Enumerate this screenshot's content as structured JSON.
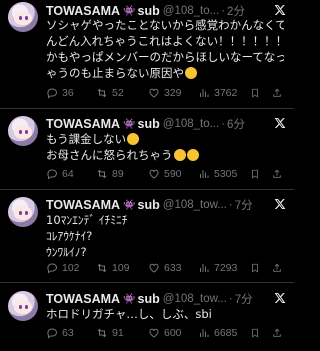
{
  "tweets": [
    {
      "name": "TOWASAMA",
      "badge": "👾",
      "suffix": "sub",
      "handle": "@108_to...",
      "time": "2分",
      "text_lines": [
        "ソシャゲやったことないから感覚わかんなくてど",
        "んどん入れちゃうこれはよくない！！！！！！し",
        "かもやっぱメンバーのだからほしいなーてなっち",
        "ゃうのも止まらない原因や"
      ],
      "emojis": [
        "thinking-face"
      ],
      "replies": "36",
      "retweets": "52",
      "likes": "329",
      "views": "3762"
    },
    {
      "name": "TOWASAMA",
      "badge": "👾",
      "suffix": "sub",
      "handle": "@108_to...",
      "time": "6分",
      "text_lines": [
        "もう課金しない",
        "お母さんに怒られちゃう"
      ],
      "emojis": [
        "sweat-smile-face",
        "crying-face",
        "grimacing-face"
      ],
      "replies": "64",
      "retweets": "89",
      "likes": "590",
      "views": "5305"
    },
    {
      "name": "TOWASAMA",
      "badge": "👾",
      "suffix": "sub",
      "handle": "@108_tow...",
      "time": "7分",
      "text_lines": [
        "10ﾏﾝｴﾝﾃﾞ ｲﾁﾐﾆﾁ",
        "ｺﾚｱｳｹﾅｲ?",
        "ｳﾝﾜﾙｲﾉ?"
      ],
      "emojis": [],
      "replies": "102",
      "retweets": "109",
      "likes": "633",
      "views": "7293"
    },
    {
      "name": "TOWASAMA",
      "badge": "👾",
      "suffix": "sub",
      "handle": "@108_tow...",
      "time": "7分",
      "text_lines": [
        "ホロドリガチャ…し、しぶ、sbi"
      ],
      "emojis": [],
      "replies": "63",
      "retweets": "91",
      "likes": "600",
      "views": "6685"
    }
  ],
  "colors": {
    "background": "#000000",
    "text": "#e7e9ea",
    "muted": "#71767b",
    "badge": "#a76df2",
    "divider": "#2f3336"
  },
  "icons": {
    "reply": "reply-icon",
    "retweet": "retweet-icon",
    "like": "heart-icon",
    "views": "views-chart-icon",
    "bookmark": "bookmark-icon",
    "share": "share-icon",
    "platform": "x-logo-icon"
  }
}
